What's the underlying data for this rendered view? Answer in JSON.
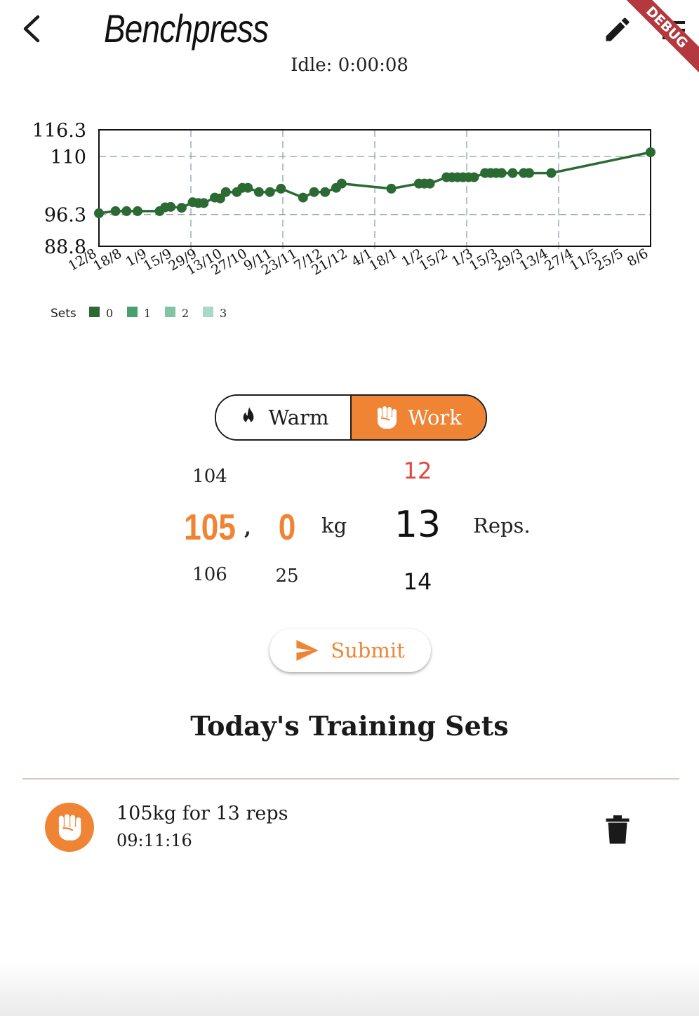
{
  "header": {
    "title": "Benchpress",
    "idle": "Idle: 0:00:08",
    "debug_banner": "DEBUG",
    "icons": [
      "back-arrow-icon",
      "pencil-icon",
      "menu-icon"
    ]
  },
  "chart_data": {
    "type": "line",
    "y_ticks": [
      116.3,
      110,
      96.3,
      88.8
    ],
    "ylim": [
      88.8,
      116.3
    ],
    "x_tick_labels": [
      "12/8",
      "18/8",
      "1/9",
      "15/9",
      "29/9",
      "13/10",
      "27/10",
      "9/11",
      "23/11",
      "7/12",
      "21/12",
      "4/1",
      "18/1",
      "1/2",
      "15/2",
      "1/3",
      "15/3",
      "29/3",
      "13/4",
      "27/4",
      "11/5",
      "25/5",
      "8/6"
    ],
    "series": [
      {
        "name": "0",
        "color": "#2b6b33",
        "points": [
          [
            0.0,
            96.6
          ],
          [
            0.03,
            97.1
          ],
          [
            0.05,
            97.1
          ],
          [
            0.07,
            97.1
          ],
          [
            0.11,
            97.1
          ],
          [
            0.12,
            98.0
          ],
          [
            0.13,
            98.1
          ],
          [
            0.15,
            97.9
          ],
          [
            0.17,
            99.2
          ],
          [
            0.18,
            99.0
          ],
          [
            0.19,
            99.0
          ],
          [
            0.21,
            100.3
          ],
          [
            0.22,
            100.1
          ],
          [
            0.23,
            101.6
          ],
          [
            0.25,
            101.6
          ],
          [
            0.26,
            102.6
          ],
          [
            0.27,
            102.6
          ],
          [
            0.29,
            101.6
          ],
          [
            0.31,
            101.6
          ],
          [
            0.33,
            102.4
          ],
          [
            0.37,
            100.3
          ],
          [
            0.39,
            101.6
          ],
          [
            0.41,
            101.6
          ],
          [
            0.43,
            102.6
          ],
          [
            0.44,
            103.6
          ],
          [
            0.53,
            102.4
          ],
          [
            0.58,
            103.6
          ],
          [
            0.59,
            103.6
          ],
          [
            0.6,
            103.6
          ],
          [
            0.63,
            105.1
          ],
          [
            0.64,
            105.1
          ],
          [
            0.65,
            105.1
          ],
          [
            0.66,
            105.1
          ],
          [
            0.67,
            105.1
          ],
          [
            0.68,
            105.1
          ],
          [
            0.7,
            106.1
          ],
          [
            0.71,
            106.1
          ],
          [
            0.72,
            106.1
          ],
          [
            0.73,
            106.1
          ],
          [
            0.75,
            106.1
          ],
          [
            0.77,
            106.1
          ],
          [
            0.78,
            106.1
          ],
          [
            0.82,
            106.1
          ],
          [
            1.0,
            111.0
          ]
        ]
      }
    ],
    "legend": {
      "title": "Sets",
      "items": [
        {
          "label": "0",
          "color": "#2b6b33"
        },
        {
          "label": "1",
          "color": "#4aa06a"
        },
        {
          "label": "2",
          "color": "#84c4a4"
        },
        {
          "label": "3",
          "color": "#a9d9c8"
        }
      ]
    },
    "grid": true
  },
  "mode_toggle": {
    "warm_label": "Warm",
    "work_label": "Work",
    "selected": "Work"
  },
  "pickers": {
    "weight_whole": {
      "above": "104",
      "selected": "105",
      "below": "106"
    },
    "separator": ",",
    "weight_fraction": {
      "selected": "0",
      "below": "25"
    },
    "weight_unit": "kg",
    "reps": {
      "above": "12",
      "selected": "13",
      "below": "14"
    },
    "reps_unit": "Reps."
  },
  "submit_label": "Submit",
  "sets_heading": "Today's Training Sets",
  "sets": [
    {
      "description": "105kg for 13 reps",
      "time": "09:11:16"
    }
  ],
  "colors": {
    "accent": "#ef8435",
    "line": "#2b6b33",
    "reps_above": "#e0463c"
  }
}
